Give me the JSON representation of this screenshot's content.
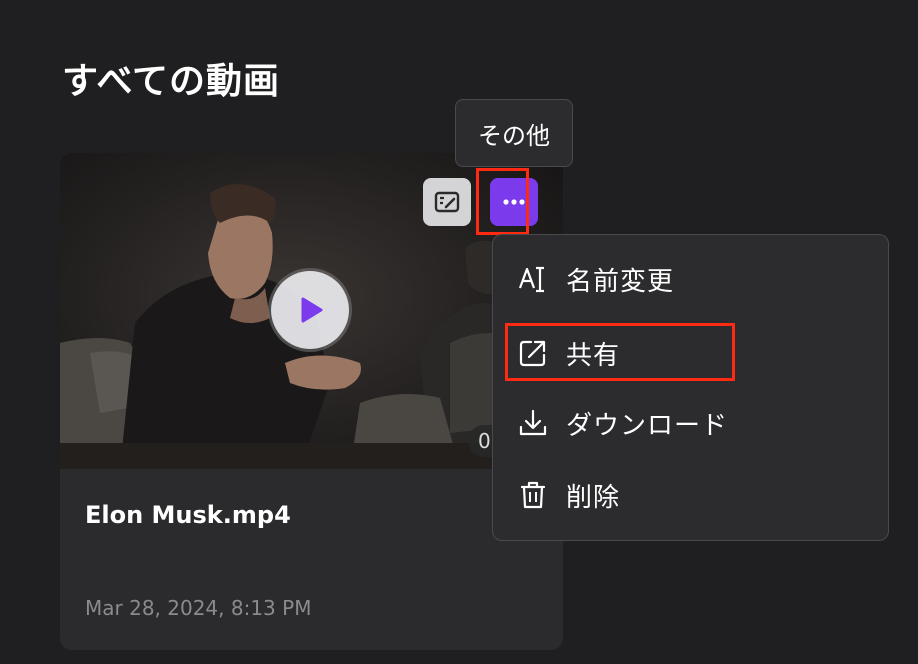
{
  "page": {
    "title": "すべての動画"
  },
  "video_card": {
    "title": "Elon Musk.mp4",
    "date": "Mar 28, 2024, 8:13 PM",
    "duration_partial": "0",
    "edit_icon": "edit-icon",
    "more_icon": "more-dots-icon",
    "play_icon": "play-icon",
    "accent_color": "#7c3aed"
  },
  "tooltip": {
    "text": "その他"
  },
  "menu": {
    "items": [
      {
        "label": "名前変更",
        "icon": "rename-icon"
      },
      {
        "label": "共有",
        "icon": "share-icon"
      },
      {
        "label": "ダウンロード",
        "icon": "download-icon"
      },
      {
        "label": "削除",
        "icon": "trash-icon"
      }
    ]
  },
  "highlight_color": "#ff2a12"
}
